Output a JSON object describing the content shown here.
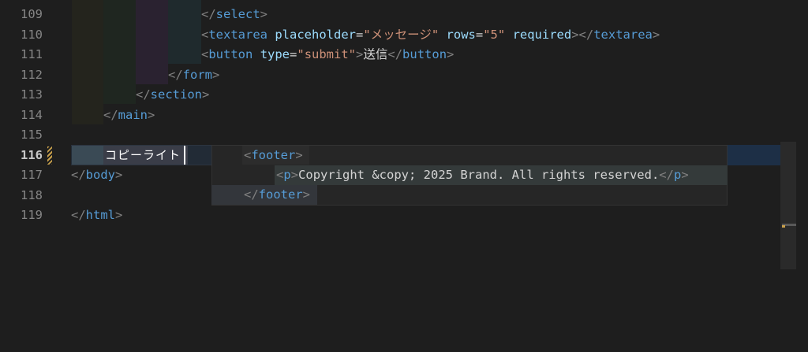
{
  "editor": {
    "lines": [
      {
        "num": "109",
        "indent": 255,
        "tokens": [
          {
            "t": "</",
            "c": "punc"
          },
          {
            "t": "select",
            "c": "tag"
          },
          {
            "t": ">",
            "c": "punc"
          }
        ]
      },
      {
        "num": "110",
        "indent": 255,
        "tokens": [
          {
            "t": "<",
            "c": "punc"
          },
          {
            "t": "textarea",
            "c": "tag"
          },
          {
            "t": " ",
            "c": "text"
          },
          {
            "t": "placeholder",
            "c": "attr"
          },
          {
            "t": "=",
            "c": "eq"
          },
          {
            "t": "\"メッセージ\"",
            "c": "str"
          },
          {
            "t": " ",
            "c": "text"
          },
          {
            "t": "rows",
            "c": "attr"
          },
          {
            "t": "=",
            "c": "eq"
          },
          {
            "t": "\"5\"",
            "c": "str"
          },
          {
            "t": " ",
            "c": "text"
          },
          {
            "t": "required",
            "c": "attr"
          },
          {
            "t": "></",
            "c": "punc"
          },
          {
            "t": "textarea",
            "c": "tag"
          },
          {
            "t": ">",
            "c": "punc"
          }
        ]
      },
      {
        "num": "111",
        "indent": 255,
        "tokens": [
          {
            "t": "<",
            "c": "punc"
          },
          {
            "t": "button",
            "c": "tag"
          },
          {
            "t": " ",
            "c": "text"
          },
          {
            "t": "type",
            "c": "attr"
          },
          {
            "t": "=",
            "c": "eq"
          },
          {
            "t": "\"submit\"",
            "c": "str"
          },
          {
            "t": ">",
            "c": "punc"
          },
          {
            "t": "送信",
            "c": "text"
          },
          {
            "t": "</",
            "c": "punc"
          },
          {
            "t": "button",
            "c": "tag"
          },
          {
            "t": ">",
            "c": "punc"
          }
        ]
      },
      {
        "num": "112",
        "indent": 213,
        "tokens": [
          {
            "t": "</",
            "c": "punc"
          },
          {
            "t": "form",
            "c": "tag"
          },
          {
            "t": ">",
            "c": "punc"
          }
        ]
      },
      {
        "num": "113",
        "indent": 172,
        "tokens": [
          {
            "t": "</",
            "c": "punc"
          },
          {
            "t": "section",
            "c": "tag"
          },
          {
            "t": ">",
            "c": "punc"
          }
        ]
      },
      {
        "num": "114",
        "indent": 131,
        "tokens": [
          {
            "t": "</",
            "c": "punc"
          },
          {
            "t": "main",
            "c": "tag"
          },
          {
            "t": ">",
            "c": "punc"
          }
        ]
      },
      {
        "num": "115",
        "indent": 90,
        "tokens": []
      },
      {
        "num": "116",
        "indent": 90,
        "current": true,
        "tokens": []
      },
      {
        "num": "117",
        "indent": 90,
        "tokens": [
          {
            "t": "</",
            "c": "punc"
          },
          {
            "t": "body",
            "c": "tag"
          },
          {
            "t": ">",
            "c": "punc"
          }
        ]
      },
      {
        "num": "118",
        "indent": 90,
        "tokens": []
      },
      {
        "num": "119",
        "indent": 90,
        "tokens": [
          {
            "t": "</",
            "c": "punc"
          },
          {
            "t": "html",
            "c": "tag"
          },
          {
            "t": ">",
            "c": "punc"
          }
        ]
      }
    ]
  },
  "ime": {
    "composition_text": "コピーライト"
  },
  "suggestion": {
    "lines": [
      {
        "tokens": [
          {
            "t": "<",
            "c": "punc"
          },
          {
            "t": "footer",
            "c": "tag"
          },
          {
            "t": ">",
            "c": "punc"
          }
        ]
      },
      {
        "tokens": [
          {
            "t": "<",
            "c": "punc"
          },
          {
            "t": "p",
            "c": "tag"
          },
          {
            "t": ">",
            "c": "punc"
          },
          {
            "t": "Copyright &copy; 2025 Brand. All rights reserved.",
            "c": "text"
          },
          {
            "t": "</",
            "c": "punc"
          },
          {
            "t": "p",
            "c": "tag"
          },
          {
            "t": ">",
            "c": "punc"
          }
        ]
      },
      {
        "tokens": [
          {
            "t": "</",
            "c": "punc"
          },
          {
            "t": "footer",
            "c": "tag"
          },
          {
            "t": ">",
            "c": "punc"
          }
        ]
      }
    ]
  },
  "colors": {
    "background": "#1e1e1e",
    "tag": "#569cd6",
    "attribute": "#9cdcfe",
    "string": "#ce9178",
    "punctuation": "#808080",
    "modified_marker": "#c9a04b"
  }
}
